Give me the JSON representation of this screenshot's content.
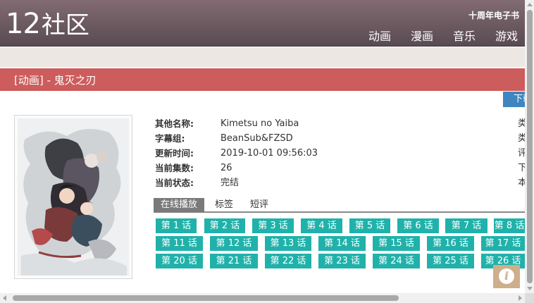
{
  "site": {
    "logo_num": "12",
    "logo_text": "社区",
    "header_link": "十周年电子书",
    "nav": [
      "动画",
      "漫画",
      "音乐",
      "游戏"
    ]
  },
  "title_bar": {
    "text": "[动画] - 鬼灭之刃"
  },
  "download_button": {
    "label": "下载"
  },
  "info": [
    {
      "label": "其他名称:",
      "value": "Kimetsu no Yaiba",
      "right": "类"
    },
    {
      "label": "字幕组:",
      "value": "BeanSub&FZSD",
      "right": "类"
    },
    {
      "label": "更新时间:",
      "value": "2019-10-01 09:56:03",
      "right": "评"
    },
    {
      "label": "当前集数:",
      "value": "26",
      "right": "下"
    },
    {
      "label": "当前状态:",
      "value": "完结",
      "right": "本"
    }
  ],
  "tabs": [
    "在线播放",
    "标签",
    "短评"
  ],
  "episodes": [
    [
      "第 1 话",
      "第 2 话",
      "第 3 话",
      "第 4 话",
      "第 5 话",
      "第 6 话",
      "第 7 话",
      "第 8 话"
    ],
    [
      "第 11 话",
      "第 12 话",
      "第 13 话",
      "第 14 话",
      "第 15 话",
      "第 16 话",
      "第 17 话"
    ],
    [
      "第 20 话",
      "第 21 话",
      "第 22 话",
      "第 23 话",
      "第 24 话",
      "第 25 话",
      "第 26 话"
    ]
  ],
  "colors": {
    "header": "#6d5a61",
    "title_bar": "#cd5c5c",
    "episode_button": "#20b2aa",
    "tab_active": "#7a7a7a",
    "download_button": "#3f85bf",
    "info_icon_bg": "#cfae8a"
  },
  "icons": {
    "info_button": "info-icon"
  }
}
